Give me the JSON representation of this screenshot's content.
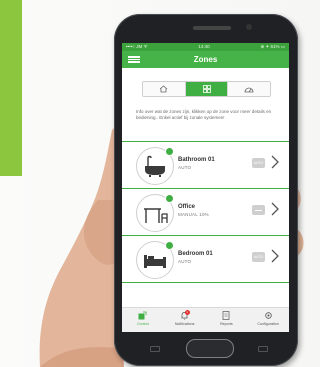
{
  "status_bar": {
    "left": "••••○ JM ᯤ",
    "time": "14:40",
    "right": "⊕ ✦ 61% ▭"
  },
  "appbar": {
    "title": "Zones"
  },
  "tabs": [
    {
      "icon": "house-icon",
      "active": false
    },
    {
      "icon": "zones-grid-icon",
      "active": true
    },
    {
      "icon": "gauge-icon",
      "active": false
    }
  ],
  "info_text": "Info over wat de zones zijn, klikken op de zone voor meer details en bediening.. Enkel actief bij zonale systemen!",
  "zones": [
    {
      "name": "Bathroom 01",
      "mode": "AUTO",
      "badge": "AUTO",
      "icon": "bathtub-icon"
    },
    {
      "name": "Office",
      "mode": "MANUAL 10%",
      "badge": "",
      "icon": "desk-chair-icon"
    },
    {
      "name": "Bedroom 01",
      "mode": "AUTO",
      "badge": "AUTO",
      "icon": "bed-icon"
    }
  ],
  "bottom_nav": [
    {
      "label": "Control",
      "icon": "control-icon",
      "active": true
    },
    {
      "label": "Notifications",
      "icon": "bell-icon",
      "active": false,
      "badge": "1"
    },
    {
      "label": "Reports",
      "icon": "report-icon",
      "active": false
    },
    {
      "label": "Configuration",
      "icon": "gear-icon",
      "active": false
    }
  ],
  "colors": {
    "accent": "#3fae43",
    "brand_bar": "#8cc63f"
  }
}
